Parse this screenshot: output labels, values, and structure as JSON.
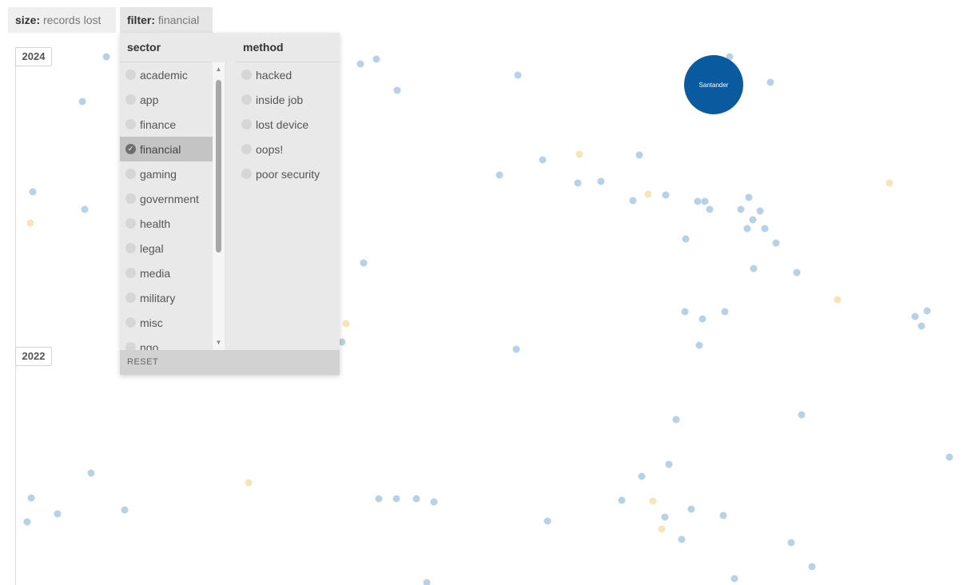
{
  "tabs": {
    "size": {
      "key": "size:",
      "value": "records lost"
    },
    "filter": {
      "key": "filter:",
      "value": "financial"
    }
  },
  "years": [
    "2024",
    "2022"
  ],
  "filter_panel": {
    "sector_header": "sector",
    "method_header": "method",
    "sectors": [
      {
        "label": "academic",
        "selected": false
      },
      {
        "label": "app",
        "selected": false
      },
      {
        "label": "finance",
        "selected": false
      },
      {
        "label": "financial",
        "selected": true
      },
      {
        "label": "gaming",
        "selected": false
      },
      {
        "label": "government",
        "selected": false
      },
      {
        "label": "health",
        "selected": false
      },
      {
        "label": "legal",
        "selected": false
      },
      {
        "label": "media",
        "selected": false
      },
      {
        "label": "military",
        "selected": false
      },
      {
        "label": "misc",
        "selected": false
      },
      {
        "label": "ngo",
        "selected": false
      }
    ],
    "methods": [
      "hacked",
      "inside job",
      "lost device",
      "oops!",
      "poor security"
    ],
    "reset_label": "RESET",
    "check_icon": "check-icon",
    "scroll_up_icon": "scroll-up-arrow-icon",
    "scroll_down_icon": "scroll-down-arrow-icon"
  },
  "highlighted_breach": {
    "label": "Santander",
    "color": "#0a5a9f"
  },
  "colors": {
    "dot_blue": "#b7d1e6",
    "dot_yellow": "#f7e5b8",
    "highlight": "#0a5a9f"
  }
}
